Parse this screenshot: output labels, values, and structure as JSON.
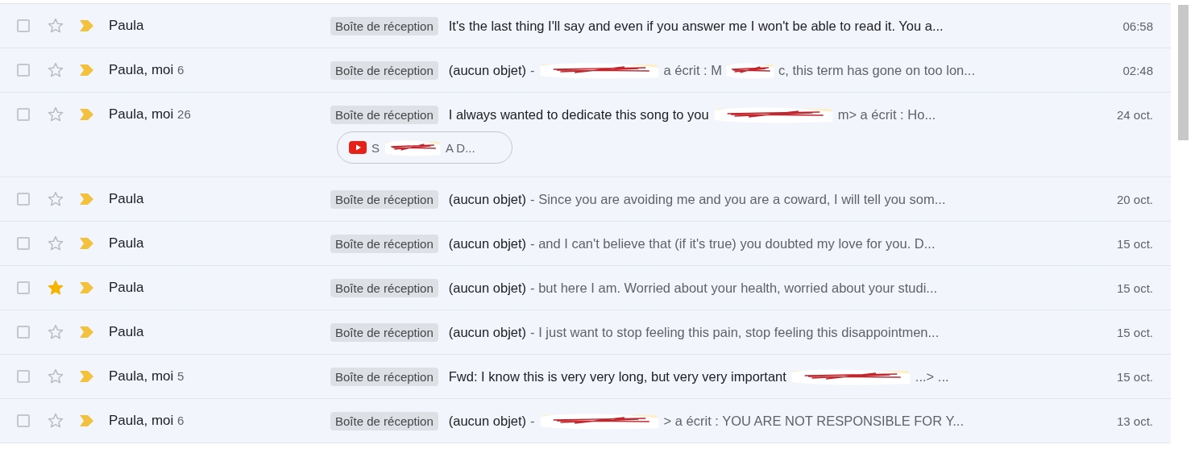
{
  "messages": [
    {
      "sender": "Paula",
      "checked": false,
      "starred": false,
      "label": "Boîte de réception",
      "parts": [
        {
          "kind": "subject",
          "text": "It's the last thing I'll say and even if you answer me I won't be able to read it. You a..."
        }
      ],
      "date": "06:58"
    },
    {
      "sender": "Paula, moi",
      "count": "6",
      "checked": false,
      "starred": false,
      "label": "Boîte de réception",
      "parts": [
        {
          "kind": "subject",
          "text": "(aucun objet)"
        },
        {
          "kind": "snippet",
          "text": "-"
        },
        {
          "kind": "redaction"
        },
        {
          "kind": "snippet",
          "text": "a écrit : M"
        },
        {
          "kind": "redaction"
        },
        {
          "kind": "snippet",
          "text": "c, this term has gone on too lon..."
        }
      ],
      "date": "02:48"
    },
    {
      "sender": "Paula, moi",
      "count": "26",
      "checked": false,
      "starred": false,
      "label": "Boîte de réception",
      "parts": [
        {
          "kind": "subject",
          "text": "I always wanted to dedicate this song to you"
        },
        {
          "kind": "redaction"
        },
        {
          "kind": "snippet",
          "text": "m> a écrit : Ho..."
        }
      ],
      "attachment": {
        "parts": [
          {
            "kind": "snippet",
            "text": "S"
          },
          {
            "kind": "redaction"
          },
          {
            "kind": "snippet",
            "text": "A D..."
          }
        ]
      },
      "date": "24 oct."
    },
    {
      "sender": "Paula",
      "checked": false,
      "starred": false,
      "label": "Boîte de réception",
      "parts": [
        {
          "kind": "subject",
          "text": "(aucun objet)"
        },
        {
          "kind": "snippet",
          "text": "- Since you are avoiding me and you are a coward, I will tell you som..."
        }
      ],
      "date": "20 oct."
    },
    {
      "sender": "Paula",
      "checked": false,
      "starred": false,
      "label": "Boîte de réception",
      "parts": [
        {
          "kind": "subject",
          "text": "(aucun objet)"
        },
        {
          "kind": "snippet",
          "text": "- and I can't believe that (if it's true) you doubted my love for you. D..."
        }
      ],
      "date": "15 oct."
    },
    {
      "sender": "Paula",
      "checked": false,
      "starred": true,
      "label": "Boîte de réception",
      "parts": [
        {
          "kind": "subject",
          "text": "(aucun objet)"
        },
        {
          "kind": "snippet",
          "text": "- but here I am. Worried about your health, worried about your studi..."
        }
      ],
      "date": "15 oct."
    },
    {
      "sender": "Paula",
      "checked": false,
      "starred": false,
      "label": "Boîte de réception",
      "parts": [
        {
          "kind": "subject",
          "text": "(aucun objet)"
        },
        {
          "kind": "snippet",
          "text": "- I just want to stop feeling this pain, stop feeling this disappointmen..."
        }
      ],
      "date": "15 oct."
    },
    {
      "sender": "Paula, moi",
      "count": "5",
      "checked": false,
      "starred": false,
      "label": "Boîte de réception",
      "parts": [
        {
          "kind": "subject",
          "text": "Fwd: I know this is very very long, but very very important"
        },
        {
          "kind": "redaction"
        },
        {
          "kind": "snippet",
          "text": "...> ..."
        }
      ],
      "date": "15 oct."
    },
    {
      "sender": "Paula, moi",
      "count": "6",
      "checked": false,
      "starred": false,
      "label": "Boîte de réception",
      "parts": [
        {
          "kind": "subject",
          "text": "(aucun objet)"
        },
        {
          "kind": "snippet",
          "text": "-"
        },
        {
          "kind": "redaction"
        },
        {
          "kind": "snippet",
          "text": "> a écrit : YOU ARE NOT RESPONSIBLE FOR Y..."
        }
      ],
      "date": "13 oct."
    }
  ]
}
